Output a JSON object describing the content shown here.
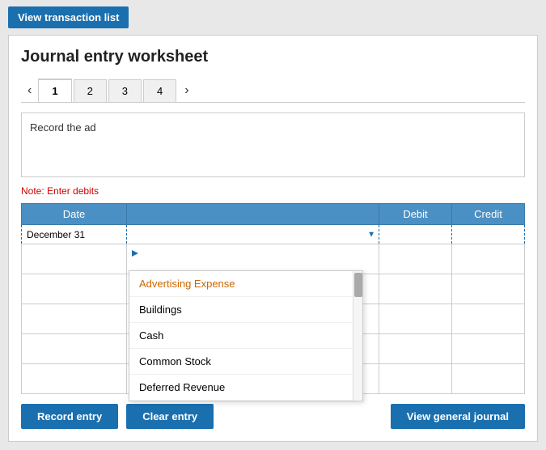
{
  "topbar": {
    "view_transaction_btn": "View transaction list"
  },
  "worksheet": {
    "title": "Journal entry worksheet",
    "tabs": [
      {
        "label": "1",
        "active": true
      },
      {
        "label": "2"
      },
      {
        "label": "3"
      },
      {
        "label": "4"
      }
    ],
    "instruction_text": "Record the ad",
    "note_text": "Note: Enter debits",
    "table": {
      "headers": {
        "date": "Date",
        "account": "",
        "debit": "Debit",
        "credit": "Credit"
      },
      "rows": [
        {
          "date": "December 31",
          "account": "",
          "debit": "",
          "credit": ""
        },
        {
          "date": "",
          "account": "",
          "debit": "",
          "credit": ""
        },
        {
          "date": "",
          "account": "",
          "debit": "",
          "credit": ""
        },
        {
          "date": "",
          "account": "",
          "debit": "",
          "credit": ""
        },
        {
          "date": "",
          "account": "",
          "debit": "",
          "credit": ""
        },
        {
          "date": "",
          "account": "",
          "debit": "",
          "credit": ""
        }
      ]
    }
  },
  "dropdown": {
    "items": [
      {
        "label": "Advertising Expense",
        "class": "advertising"
      },
      {
        "label": "Buildings"
      },
      {
        "label": "Cash"
      },
      {
        "label": "Common Stock"
      },
      {
        "label": "Deferred Revenue"
      }
    ]
  },
  "buttons": {
    "record_entry": "Record entry",
    "clear_entry": "Clear entry",
    "view_general_journal": "View general journal"
  }
}
